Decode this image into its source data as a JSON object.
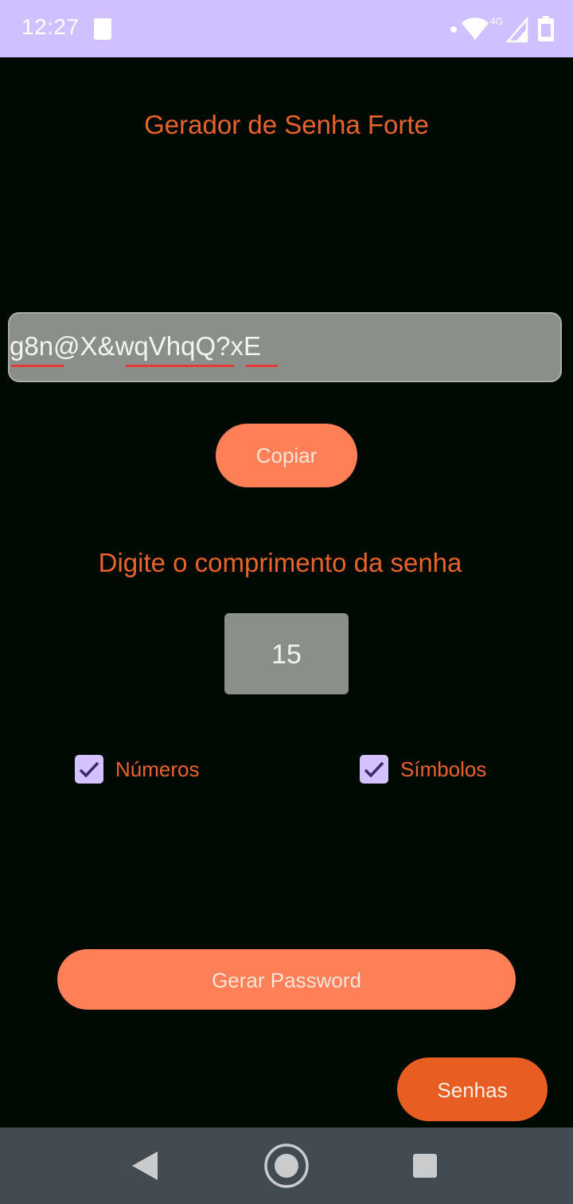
{
  "status_bar": {
    "time": "12:27",
    "icons": [
      "document-icon",
      "dot-icon",
      "wifi-icon",
      "signal-4g-icon",
      "battery-icon"
    ]
  },
  "app": {
    "title": "Gerador de Senha Forte"
  },
  "password": {
    "value": "g8n@X&wqVhqQ?xE"
  },
  "copy_button": {
    "label": "Copiar"
  },
  "length": {
    "label": "Digite o comprimento da senha",
    "value": "15"
  },
  "options": {
    "numbers": {
      "label": "Números",
      "checked": true
    },
    "symbols": {
      "label": "Símbolos",
      "checked": true
    }
  },
  "generate_button": {
    "label": "Gerar Password"
  },
  "history_button": {
    "label": "Senhas"
  },
  "nav_bar": {
    "icons": [
      "back-icon",
      "home-icon",
      "recents-icon"
    ]
  },
  "colors": {
    "background": "#000a03",
    "status_bar": "#d0c0ff",
    "accent_text": "#e8632c",
    "button": "#ff7f57",
    "button_dark": "#e85e22",
    "field": "#8a8f89",
    "checkbox": "#d3c2ff",
    "nav_bar": "#424a52"
  }
}
